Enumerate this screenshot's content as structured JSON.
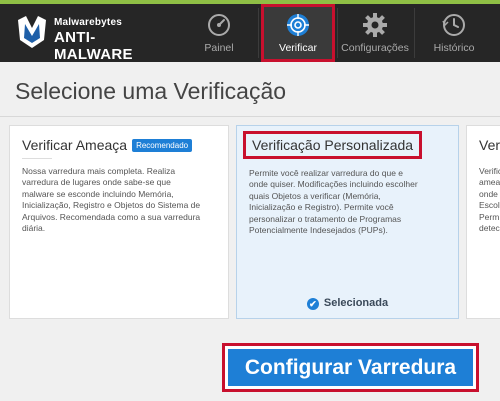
{
  "app": {
    "brand_top": "Malwarebytes",
    "brand_bottom": "ANTI-MALWARE"
  },
  "nav": {
    "items": [
      {
        "label": "Painel",
        "icon": "dashboard-gauge-icon"
      },
      {
        "label": "Verificar",
        "icon": "scan-target-icon",
        "active": true
      },
      {
        "label": "Configurações",
        "icon": "gear-icon"
      },
      {
        "label": "Histórico",
        "icon": "clock-history-icon"
      }
    ]
  },
  "page": {
    "title": "Selecione uma Verificação"
  },
  "cards": [
    {
      "title": "Verificar Ameaça",
      "badge": "Recomendado",
      "description_lines": [
        "Nossa varredura mais completa. Realiza",
        "varredura de lugares onde sabe-se que",
        "malware se esconde incluindo Memória,",
        "Inicialização, Registro e Objetos do Sistema de",
        "Arquivos. Recomendada como a sua varredura",
        "diária."
      ]
    },
    {
      "title": "Verificação Personalizada",
      "selected": true,
      "selected_label": "Selecionada",
      "description_lines": [
        "Permite você realizar varredura do que e",
        "onde quiser. Modificações incluindo escolher",
        "quais Objetos a verificar (Memória,",
        "Inicialização e Registro). Permite você",
        "personalizar o tratamento de Programas",
        "Potencialmente Indesejados (PUPs)."
      ]
    },
    {
      "title": "Verif",
      "description_lines": [
        "Verific",
        "ameaç",
        "onde",
        "Escolh",
        "Perm",
        "detec"
      ]
    }
  ],
  "actions": {
    "configure_label": "Configurar Varredura"
  },
  "colors": {
    "accent": "#1e7fd6",
    "highlight": "#c8102e",
    "topbar": "#262626",
    "window_border": "#8fbf45"
  }
}
